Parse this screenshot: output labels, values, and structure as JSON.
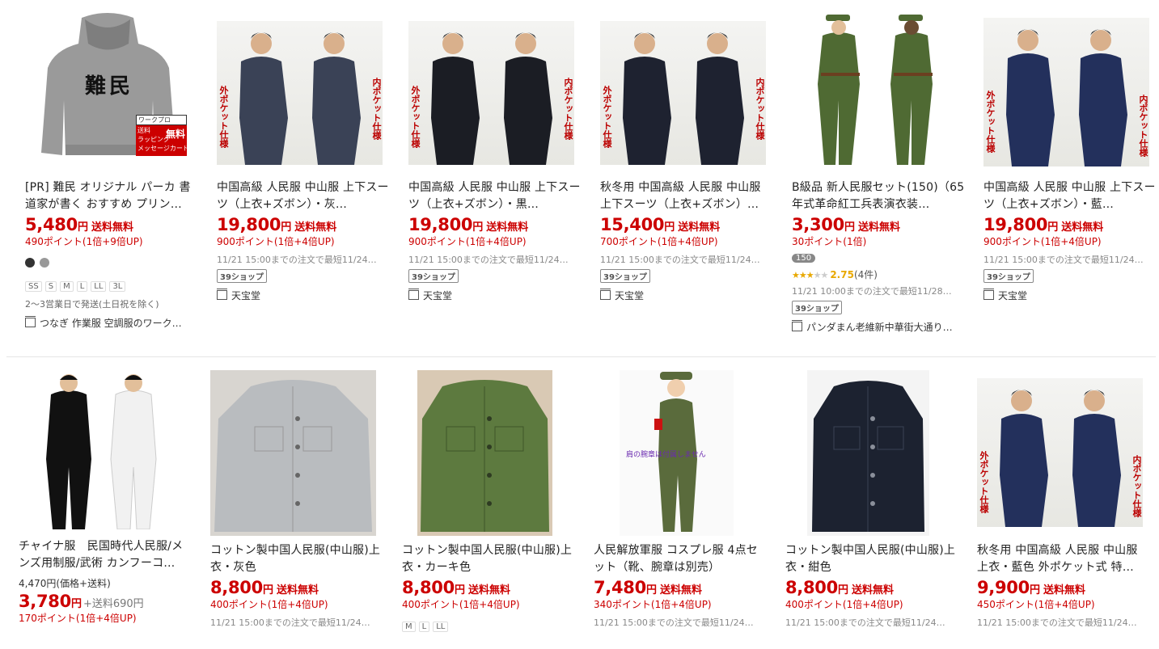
{
  "colors": {
    "price": "#cc0000",
    "points": "#cc0000",
    "muted": "#888888"
  },
  "row1": [
    {
      "image_name": "hoodie-image",
      "title": "[PR] 難民 オリジナル パーカ 書道家が書く おすすめ プリン…",
      "price": "5,480",
      "yen": "円",
      "free": "送料無料",
      "points": "490ポイント(1倍+9倍UP)",
      "swatches": [
        "#333333",
        "#999999"
      ],
      "sizes": [
        "SS",
        "S",
        "M",
        "L",
        "LL",
        "3L"
      ],
      "note": "2〜3営業日で発送(土日祝を除く)",
      "shop": "つなぎ 作業服 空調服のワーク…",
      "hoodie_text": "難民",
      "badge_top": "ワークプロ",
      "badge_ship": "送料",
      "badge_free": "無料",
      "badge_wrap": "ラッピング",
      "badge_msg": "メッセージカード"
    },
    {
      "image_name": "suit-gray-image",
      "title": "中国高級 人民服 中山服 上下スーツ（上衣+ズボン）・灰…",
      "price": "19,800",
      "yen": "円",
      "free": "送料無料",
      "points": "900ポイント(1倍+4倍UP)",
      "delivery": "11/21 15:00までの注文で最短11/24…",
      "tag": "39ショップ",
      "shop": "天宝堂",
      "left_text": "外ポケット仕様",
      "right_text": "内ポケット仕様"
    },
    {
      "image_name": "suit-black-image",
      "title": "中国高級 人民服 中山服 上下スーツ（上衣+ズボン）・黒…",
      "price": "19,800",
      "yen": "円",
      "free": "送料無料",
      "points": "900ポイント(1倍+4倍UP)",
      "delivery": "11/21 15:00までの注文で最短11/24…",
      "tag": "39ショップ",
      "shop": "天宝堂",
      "left_text": "外ポケット仕様",
      "right_text": "内ポケット仕様"
    },
    {
      "image_name": "suit-autumn-image",
      "title": "秋冬用 中国高級 人民服 中山服 上下スーツ（上衣+ズボン）…",
      "price": "15,400",
      "yen": "円",
      "free": "送料無料",
      "points": "700ポイント(1倍+4倍UP)",
      "delivery": "11/21 15:00までの注文で最短11/24…",
      "tag": "39ショップ",
      "shop": "天宝堂",
      "left_text": "外ポケット仕様",
      "right_text": "内ポケット仕様"
    },
    {
      "image_name": "army-uniform-image",
      "title": "B級品 新人民服セット(150)（65年式革命紅工兵表演衣装…",
      "price": "3,300",
      "yen": "円",
      "free": "送料無料",
      "points": "30ポイント(1倍)",
      "badge": "150",
      "rating": "2.75",
      "review_count": "(4件)",
      "delivery": "11/21 10:00までの注文で最短11/28…",
      "tag": "39ショップ",
      "shop": "パンダまん老維新中華街大通り…"
    },
    {
      "image_name": "suit-navy-image",
      "title": "中国高級 人民服 中山服 上下スーツ（上衣+ズボン）・藍…",
      "price": "19,800",
      "yen": "円",
      "free": "送料無料",
      "points": "900ポイント(1倍+4倍UP)",
      "delivery": "11/21 15:00までの注文で最短11/24…",
      "tag": "39ショップ",
      "shop": "天宝堂",
      "left_text": "外ポケット仕様",
      "right_text": "内ポケット仕様"
    }
  ],
  "row2": [
    {
      "image_name": "china-suit-image",
      "title": "チャイナ服　民国時代人民服/メンズ用制服/武術 カンフーコ…",
      "orig": "4,470円(価格+送料)",
      "price": "3,780",
      "yen": "円",
      "ship": "+送料690円",
      "points": "170ポイント(1倍+4倍UP)"
    },
    {
      "image_name": "cotton-gray-jacket-image",
      "title": "コットン製中国人民服(中山服)上衣・灰色",
      "price": "8,800",
      "yen": "円",
      "free": "送料無料",
      "points": "400ポイント(1倍+4倍UP)",
      "delivery": "11/21 15:00までの注文で最短11/24…"
    },
    {
      "image_name": "cotton-khaki-jacket-image",
      "title": "コットン製中国人民服(中山服)上衣・カーキ色",
      "price": "8,800",
      "yen": "円",
      "free": "送料無料",
      "points": "400ポイント(1倍+4倍UP)",
      "sizes": [
        "M",
        "L",
        "LL"
      ]
    },
    {
      "image_name": "pla-cosplay-image",
      "title": "人民解放軍服 コスプレ服 4点セット（靴、腕章は別売）",
      "price": "7,480",
      "yen": "円",
      "free": "送料無料",
      "points": "340ポイント(1倍+4倍UP)",
      "delivery": "11/21 15:00までの注文で最短11/24…",
      "image_caption": "肩の腕章は付属しません"
    },
    {
      "image_name": "cotton-navy-jacket-image",
      "title": "コットン製中国人民服(中山服)上衣・紺色",
      "price": "8,800",
      "yen": "円",
      "free": "送料無料",
      "points": "400ポイント(1倍+4倍UP)",
      "delivery": "11/21 15:00までの注文で最短11/24…"
    },
    {
      "image_name": "suit-navy-autumn-image",
      "title": "秋冬用 中国高級 人民服 中山服 上衣・藍色 外ポケット式 特…",
      "price": "9,900",
      "yen": "円",
      "free": "送料無料",
      "points": "450ポイント(1倍+4倍UP)",
      "delivery": "11/21 15:00までの注文で最短11/24…",
      "left_text": "外ポケット仕様",
      "right_text": "内ポケット仕様"
    }
  ]
}
